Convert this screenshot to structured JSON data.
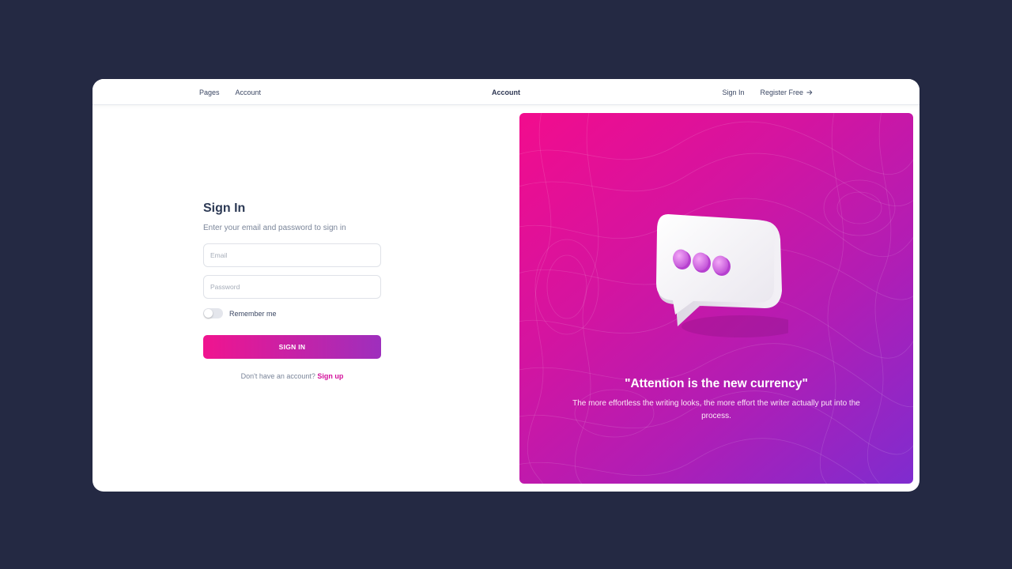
{
  "nav": {
    "pages": "Pages",
    "account": "Account",
    "brand": "Account",
    "sign_in": "Sign In",
    "register": "Register Free"
  },
  "form": {
    "title": "Sign In",
    "subtitle": "Enter your email and password to sign in",
    "email_placeholder": "Email",
    "password_placeholder": "Password",
    "remember_label": "Remember me",
    "remember_checked": false,
    "button_label": "SIGN IN",
    "signup_prompt": "Don't have an account?",
    "signup_link": "Sign up"
  },
  "hero": {
    "quote": "\"Attention is the new currency\"",
    "description": "The more effortless the writing looks, the more effort the writer actually put into the process."
  },
  "icons": {
    "register_arrow": "arrow-right-icon",
    "illustration": "chat-bubble-icon"
  },
  "colors": {
    "background": "#242943",
    "accent_pink": "#f0148f",
    "accent_purple": "#9e2fbd",
    "link": "#d3119b"
  }
}
